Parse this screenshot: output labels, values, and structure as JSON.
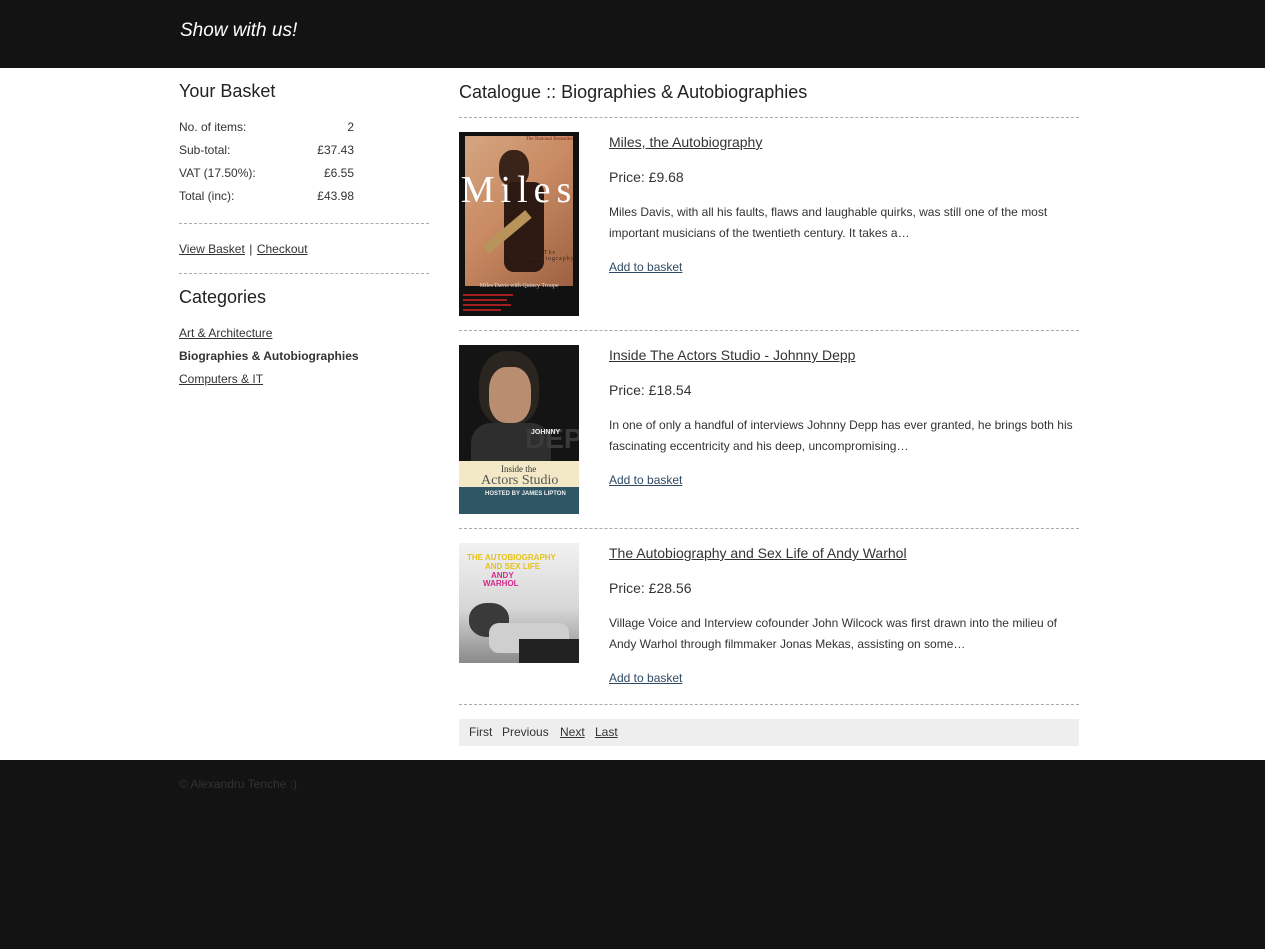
{
  "header": {
    "site_title": "Show with us!"
  },
  "basket": {
    "heading": "Your Basket",
    "rows": [
      {
        "label": "No. of items:",
        "value": "2"
      },
      {
        "label": "Sub-total:",
        "value": "£37.43"
      },
      {
        "label": "VAT (17.50%):",
        "value": "£6.55"
      },
      {
        "label": "Total (inc):",
        "value": "£43.98"
      }
    ],
    "view_label": "View Basket",
    "separator": "|",
    "checkout_label": "Checkout"
  },
  "categories": {
    "heading": "Categories",
    "items": [
      {
        "label": "Art & Architecture"
      },
      {
        "label": "Biographies & Autobiographies"
      },
      {
        "label": "Computers & IT"
      }
    ]
  },
  "catalogue": {
    "title": "Catalogue :: Biographies & Autobiographies",
    "add_label": "Add to basket",
    "products": [
      {
        "title": "Miles, the Autobiography",
        "price": "Price: £9.68",
        "description": "Miles Davis, with all his faults, flaws and laughable quirks, was still one of the most important musicians of the twentieth century. It takes a…",
        "cover": {
          "top": "The National Bestseller",
          "big": "Miles",
          "sub": "The Autobiography",
          "authors": "Miles Davis with Quincy Troupe"
        }
      },
      {
        "title": "Inside The Actors Studio - Johnny Depp",
        "price": "Price: £18.54",
        "description": "In one of only a handful of interviews Johnny Depp has ever granted, he brings both his fascinating eccentricity and his deep, uncompromising…",
        "cover": {
          "name1": "JOHNNY",
          "name2": "DEPP",
          "show1": "Inside the",
          "show2": "Actors Studio",
          "host": "HOSTED BY JAMES LIPTON"
        }
      },
      {
        "title": "The Autobiography and Sex Life of Andy Warhol",
        "price": "Price: £28.56",
        "description": "Village Voice and Interview cofounder John Wilcock was first drawn into the milieu of Andy Warhol through filmmaker Jonas Mekas, assisting on some…",
        "cover": {
          "line1": "THE AUTOBIOGRAPHY",
          "line2": "AND SEX LIFE",
          "line3": "ANDY",
          "line4": "WARHOL"
        }
      }
    ]
  },
  "pager": {
    "first": "First",
    "previous": "Previous",
    "next": "Next",
    "last": "Last"
  },
  "footer": {
    "copyright": "© Alexandru Tenche :)"
  }
}
